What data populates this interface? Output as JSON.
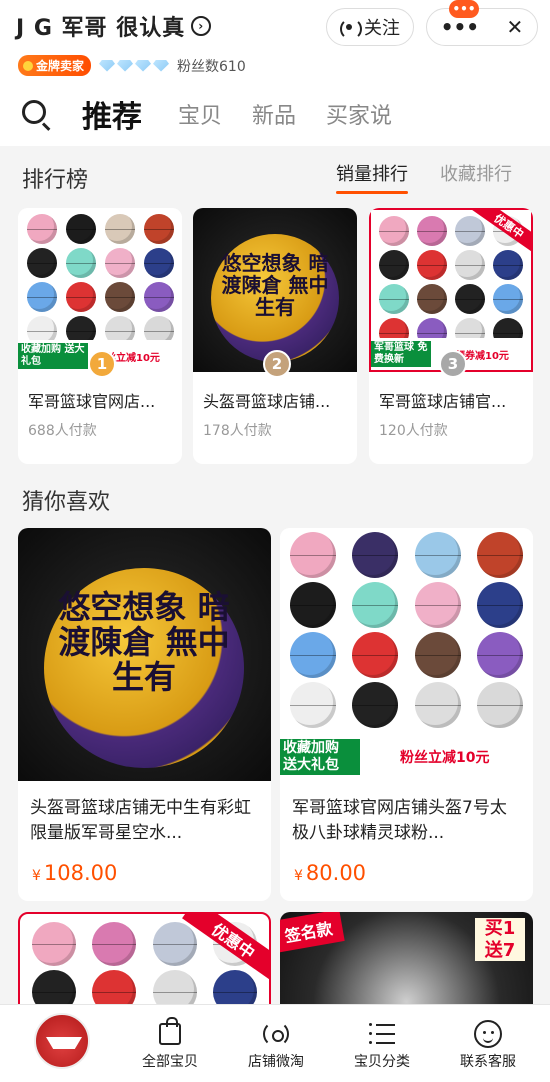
{
  "header": {
    "shop_title": "J G 军哥 很认真",
    "title_arrow": "›",
    "badge": "金牌卖家",
    "fans_label": "粉丝数610",
    "follow_label": "关注",
    "more_label": "•••",
    "close_label": "✕",
    "notify_dot": "•••"
  },
  "nav": {
    "tabs": [
      {
        "label": "推荐"
      },
      {
        "label": "宝贝"
      },
      {
        "label": "新品"
      },
      {
        "label": "买家说"
      }
    ]
  },
  "ranking": {
    "title": "排行榜",
    "tabs": [
      "销量排行",
      "收藏排行"
    ],
    "items": [
      {
        "name": "军哥篮球官网店...",
        "sold": "688人付款",
        "rank": "1",
        "promo_left": "收藏加购 送大礼包",
        "promo_right": "粉丝立减10元"
      },
      {
        "name": "头盔哥篮球店铺...",
        "sold": "178人付款",
        "rank": "2",
        "calligraphy": "悠空想象 暗渡陳倉 無中生有"
      },
      {
        "name": "军哥篮球店铺官...",
        "sold": "120人付款",
        "rank": "3",
        "corner": "优惠中",
        "promo_left": "军哥篮球 免费换新",
        "promo_right": "领券减10元"
      }
    ]
  },
  "guess": {
    "title": "猜你喜欢",
    "items": [
      {
        "name": "头盔哥篮球店铺无中生有彩虹限量版军哥星空水...",
        "price": "108.00",
        "calligraphy": "悠空想象 暗渡陳倉 無中生有"
      },
      {
        "name": "军哥篮球官网店铺头盔7号太极八卦球精灵球粉...",
        "price": "80.00",
        "promo_left": "收藏加购 送大礼包",
        "promo_right": "粉丝立减10元"
      }
    ],
    "partial": [
      {
        "corner": "优惠中"
      },
      {
        "corner": "签名款",
        "promo": "买1 送7"
      }
    ]
  },
  "currency": "¥",
  "tabbar": {
    "items": [
      {
        "label": "全部宝贝",
        "icon": "bag-icon"
      },
      {
        "label": "店铺微淘",
        "icon": "broadcast-icon"
      },
      {
        "label": "宝贝分类",
        "icon": "list-icon"
      },
      {
        "label": "联系客服",
        "icon": "service-face-icon"
      }
    ]
  },
  "colors": {
    "accent": "#ff5000",
    "gold_badge": "#ff5a1f",
    "medal_gold": "#f2a93b",
    "medal_silver": "#c4a27b",
    "medal_bronze": "#a8a8a8"
  }
}
